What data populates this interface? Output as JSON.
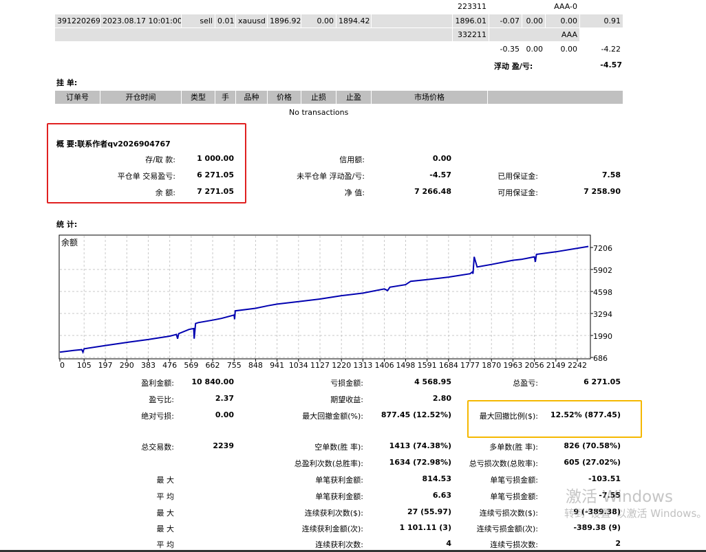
{
  "positions": {
    "row_top": {
      "comment_a": "223311",
      "comment_b": "AAA-0"
    },
    "row_main": [
      "391220269",
      "2023.08.17 10:01:00",
      "sell",
      "0.01",
      "xauusd",
      "1896.92",
      "0.00",
      "1894.42",
      "",
      "1896.01",
      "-0.07",
      "0.00",
      "0.00",
      "0.91"
    ],
    "row_sub": {
      "comment_a": "332211",
      "comment_b": "AAA"
    },
    "totals": [
      "-0.35",
      "0.00",
      "0.00",
      "-4.22"
    ],
    "floating_label": "浮动 盈/亏:",
    "floating_value": "-4.57"
  },
  "pending": {
    "title": "挂 单:",
    "headers": [
      "订单号",
      "开仓时间",
      "类型",
      "手",
      "品种",
      "价格",
      "止损",
      "止盈",
      "市场价格",
      ""
    ],
    "empty_text": "No transactions"
  },
  "summary": {
    "title": "概 要:联系作者qv2026904767",
    "rows": [
      [
        [
          "存/取 款:",
          "1 000.00"
        ],
        [
          "信用额:",
          "0.00"
        ],
        [
          "",
          ""
        ]
      ],
      [
        [
          "平仓单 交易盈亏:",
          "6 271.05"
        ],
        [
          "未平仓单 浮动盈/亏:",
          "-4.57"
        ],
        [
          "已用保证金:",
          "7.58"
        ]
      ],
      [
        [
          "余 额:",
          "7 271.05"
        ],
        [
          "净 值:",
          "7 266.48"
        ],
        [
          "可用保证金:",
          "7 258.90"
        ]
      ]
    ],
    "highlight_color": "#e02020"
  },
  "stats": {
    "title": "统 计:",
    "highlight_color": "#f5b800",
    "rows": [
      [
        [
          "盈利金额:",
          "10 840.00"
        ],
        [
          "亏损金额:",
          "4 568.95"
        ],
        [
          "总盈亏:",
          "6 271.05"
        ]
      ],
      [
        [
          "盈亏比:",
          "2.37"
        ],
        [
          "期望收益:",
          "2.80"
        ],
        [
          "",
          ""
        ]
      ],
      [
        [
          "绝对亏损:",
          "0.00"
        ],
        [
          "最大回撤金额(%):",
          "877.45 (12.52%)"
        ],
        [
          "最大回撤比例($):",
          "12.52% (877.45)"
        ]
      ],
      [
        [
          "总交易数:",
          "2239"
        ],
        [
          "空单数(胜 率):",
          "1413 (74.38%)"
        ],
        [
          "多单数(胜 率):",
          "826 (70.58%)"
        ]
      ],
      [
        [
          "",
          ""
        ],
        [
          "总盈利次数(总胜率):",
          "1634 (72.98%)"
        ],
        [
          "总亏损次数(总败率):",
          "605 (27.02%)"
        ]
      ],
      [
        [
          "最 大",
          ""
        ],
        [
          "单笔获利金额:",
          "814.53"
        ],
        [
          "单笔亏损金额:",
          "-103.51"
        ]
      ],
      [
        [
          "平 均",
          ""
        ],
        [
          "单笔获利金额:",
          "6.63"
        ],
        [
          "单笔亏损金额:",
          "-7.55"
        ]
      ],
      [
        [
          "最 大",
          ""
        ],
        [
          "连续获利次数($):",
          "27 (55.97)"
        ],
        [
          "连续亏损次数($):",
          "9 (-389.38)"
        ]
      ],
      [
        [
          "最 大",
          ""
        ],
        [
          "连续获利金额(次):",
          "1 101.11 (3)"
        ],
        [
          "连续亏损金额(次):",
          "-389.38 (9)"
        ]
      ],
      [
        [
          "平 均",
          ""
        ],
        [
          "连续获利次数:",
          "4"
        ],
        [
          "连续亏损次数:",
          "2"
        ]
      ]
    ]
  },
  "chart_data": {
    "type": "line",
    "title": "",
    "legend": "余额",
    "line_color": "#0000b0",
    "grid": true,
    "xlim": [
      0,
      2290
    ],
    "ylim": [
      686,
      7206
    ],
    "x_ticks": [
      0,
      105,
      197,
      290,
      383,
      476,
      569,
      662,
      755,
      848,
      941,
      1034,
      1127,
      1220,
      1313,
      1406,
      1498,
      1591,
      1684,
      1777,
      1870,
      1963,
      2056,
      2149,
      2242
    ],
    "y_ticks": [
      7206,
      5902,
      4598,
      3294,
      1990,
      686
    ],
    "series": [
      {
        "x": [
          0,
          60,
          95,
          100,
          105,
          200,
          300,
          383,
          476,
          505,
          510,
          515,
          560,
          580,
          582,
          588,
          600,
          662,
          700,
          755,
          757,
          760,
          848,
          900,
          941,
          1034,
          1127,
          1220,
          1313,
          1406,
          1420,
          1430,
          1498,
          1520,
          1591,
          1684,
          1777,
          1787,
          1790,
          1795,
          1808,
          1870,
          1963,
          2000,
          2056,
          2060,
          2065,
          2149,
          2290
        ],
        "y": [
          1000,
          1100,
          1150,
          1000,
          1200,
          1400,
          1600,
          1750,
          1950,
          2050,
          1800,
          2100,
          2350,
          2400,
          1800,
          2700,
          2750,
          2900,
          3000,
          3200,
          2950,
          3450,
          3600,
          3750,
          3850,
          4000,
          4150,
          4350,
          4500,
          4750,
          4650,
          4850,
          5000,
          5200,
          5300,
          5450,
          5650,
          5750,
          5650,
          6650,
          6050,
          6200,
          6450,
          6500,
          6650,
          6350,
          6800,
          6950,
          7266
        ]
      }
    ]
  },
  "watermark": {
    "line1": "激活 Windows",
    "line2": "转到“设置”以激活 Windows。"
  }
}
